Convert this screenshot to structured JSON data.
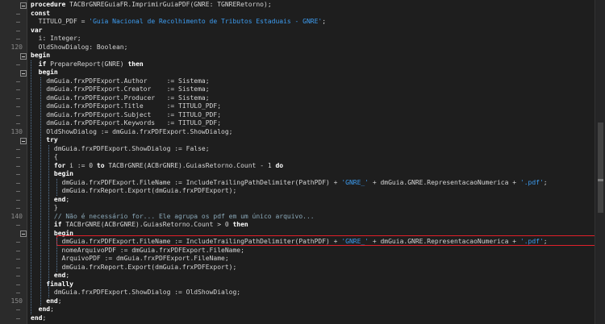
{
  "gutter": {
    "line_numbers": [
      {
        "row": 5,
        "label": "120"
      },
      {
        "row": 15,
        "label": "130"
      },
      {
        "row": 25,
        "label": "140"
      },
      {
        "row": 35,
        "label": "150"
      }
    ]
  },
  "code": {
    "lines": [
      "procedure TACBrGNREGuiaFR.ImprimirGuiaPDF(GNRE: TGNRERetorno);",
      "const",
      "  TITULO_PDF = 'Guia Nacional de Recolhimento de Tributos Estaduais - GNRE';",
      "var",
      "  i: Integer;",
      "  OldShowDialog: Boolean;",
      "begin",
      "  if PrepareReport(GNRE) then",
      "  begin",
      "    dmGuia.frxPDFExport.Author     := Sistema;",
      "    dmGuia.frxPDFExport.Creator    := Sistema;",
      "    dmGuia.frxPDFExport.Producer   := Sistema;",
      "    dmGuia.frxPDFExport.Title      := TITULO_PDF;",
      "    dmGuia.frxPDFExport.Subject    := TITULO_PDF;",
      "    dmGuia.frxPDFExport.Keywords   := TITULO_PDF;",
      "    OldShowDialog := dmGuia.frxPDFExport.ShowDialog;",
      "    try",
      "      dmGuia.frxPDFExport.ShowDialog := False;",
      "      {",
      "      for i := 0 to TACBrGNRE(ACBrGNRE).GuiasRetorno.Count - 1 do",
      "      begin",
      "        dmGuia.frxPDFExport.FileName := IncludeTrailingPathDelimiter(PathPDF) + 'GNRE_' + dmGuia.GNRE.RepresentacaoNumerica + '.pdf';",
      "        dmGuia.frxReport.Export(dmGuia.frxPDFExport);",
      "      end;",
      "      }",
      "      // Não é necessário for... Ele agrupa os pdf em um único arquivo...",
      "      if TACBrGNRE(ACBrGNRE).GuiasRetorno.Count > 0 then",
      "      begin",
      "        dmGuia.frxPDFExport.FileName := IncludeTrailingPathDelimiter(PathPDF) + 'GNRE_' + dmGuia.GNRE.RepresentacaoNumerica + '.pdf';",
      "        nomeArquivoPDF := dmGuia.frxPDFExport.FileName;",
      "        ArquivoPDF := dmGuia.frxPDFExport.FileName;",
      "        dmGuia.frxReport.Export(dmGuia.frxPDFExport);",
      "      end;",
      "    finally",
      "      dmGuia.frxPDFExport.ShowDialog := OldShowDialog;",
      "    end;",
      "  end;",
      "end;"
    ]
  },
  "colors": {
    "background": "#1e1e1e",
    "keyword": "#ffffff",
    "string": "#3d9cf0",
    "highlight_border": "#e0202a"
  }
}
